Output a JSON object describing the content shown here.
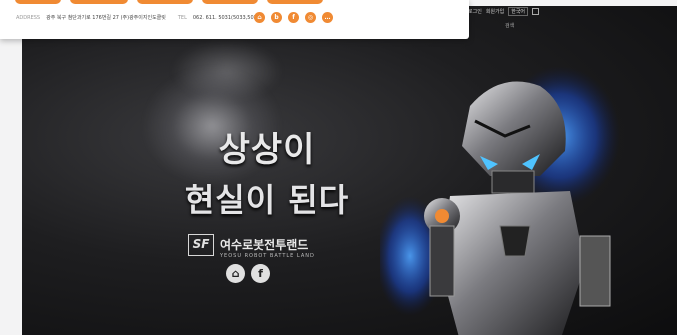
{
  "popup": {
    "address_label": "ADDRESS",
    "address": "광주 북구 첨단과기로 176번길 27 (주)광주이지인도클릿",
    "tel_label": "TEL",
    "tel": "062. 611. 5031(5033,5037)",
    "icons": [
      "home-icon",
      "blog-icon",
      "facebook-icon",
      "instagram-icon",
      "kakao-icon"
    ]
  },
  "topbar": {
    "link1": "로그인",
    "link2": "회원가입",
    "button": "한국어",
    "sub": "검색"
  },
  "hero": {
    "line1": "상상이",
    "line2": "현실이 된다",
    "logo_mark": "SF",
    "logo_name": "여수로봇전투랜드",
    "logo_sub": "YEOSU ROBOT BATTLE LAND",
    "social": [
      "home-icon",
      "facebook-icon"
    ]
  }
}
